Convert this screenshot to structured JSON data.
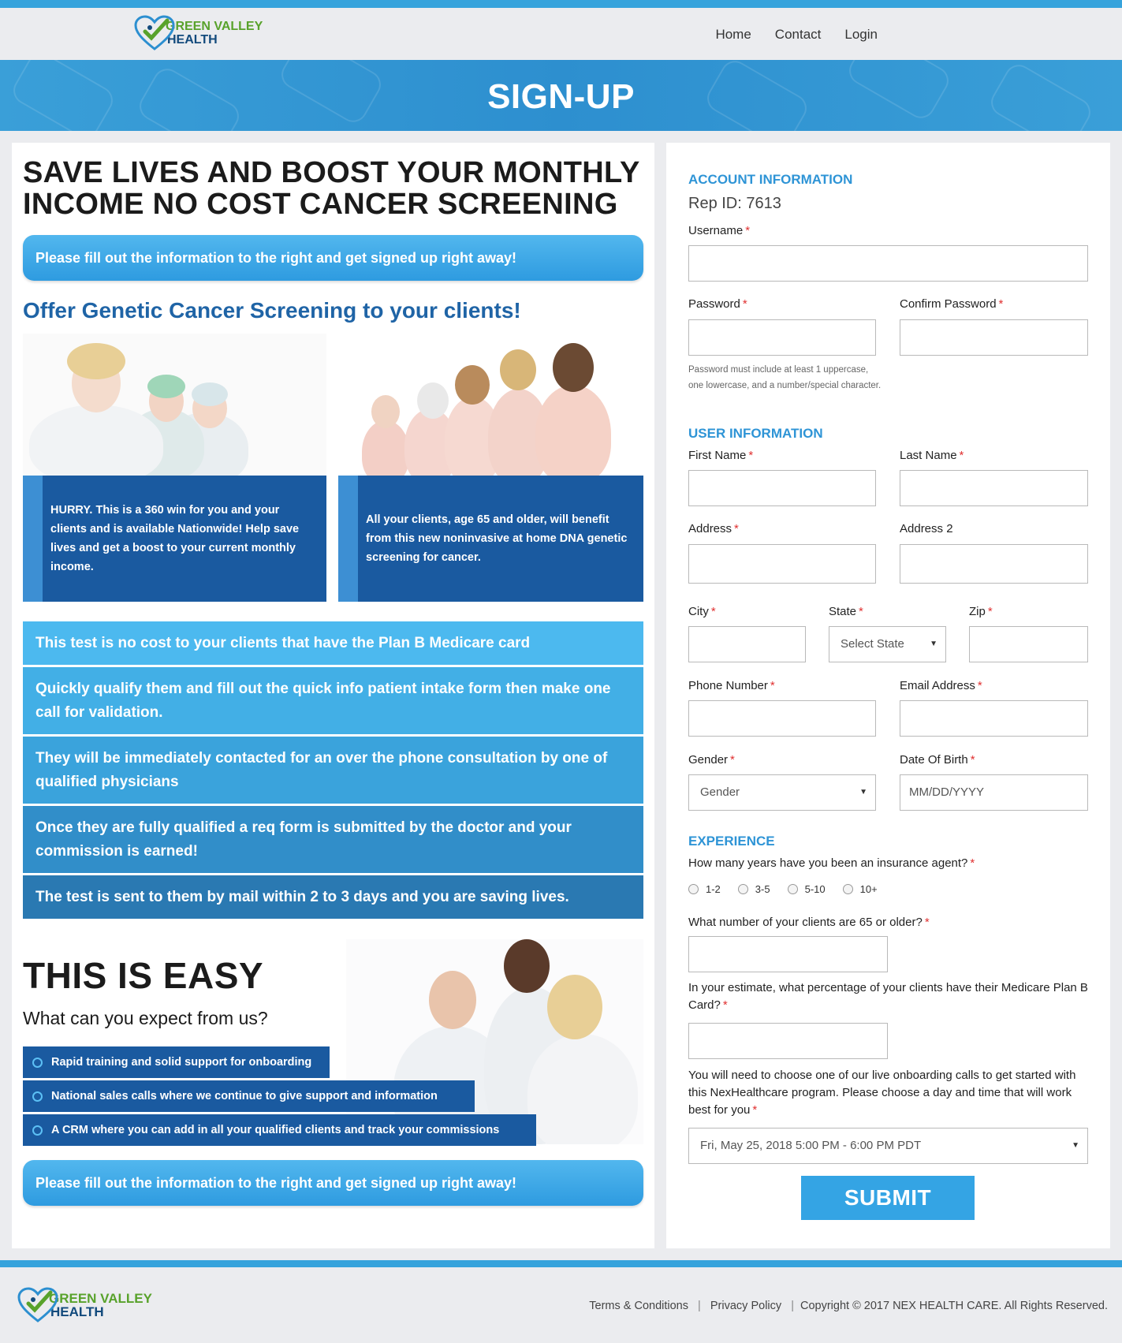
{
  "brand": {
    "line1": "GREEN VALLEY",
    "line2": "HEALTH"
  },
  "nav": {
    "home": "Home",
    "contact": "Contact",
    "login": "Login"
  },
  "banner": {
    "title": "SIGN-UP"
  },
  "left": {
    "title": "SAVE LIVES AND BOOST YOUR MONTHLY INCOME NO COST CANCER SCREENING",
    "cta_top": "Please fill out the information to the right and get signed up right away!",
    "subhead": "Offer Genetic Cancer Screening to your clients!",
    "box1": "HURRY. This is a 360 win for you and your clients and is available Nationwide! Help save lives and get a boost to your current monthly income.",
    "box2": "All your clients, age 65 and older, will benefit from this new noninvasive at home DNA genetic screening for cancer.",
    "steps": [
      "This test is no cost to your clients that have the Plan B Medicare card",
      "Quickly qualify them and fill out the quick info patient intake form then make one call for validation.",
      "They will be immediately contacted for an over the phone consultation by one of qualified physicians",
      "Once they are fully qualified a req form is submitted by the doctor and your commission is earned!",
      "The test is sent to them by mail within 2 to 3 days and you are saving lives."
    ],
    "step_colors": [
      "#4cb9ef",
      "#42afe6",
      "#3aa3dc",
      "#318ec9",
      "#2a79b2"
    ],
    "easy_title": "THIS IS EASY",
    "expect": "What can you expect from us?",
    "bullets": [
      "Rapid training and solid support for onboarding",
      "National sales calls where we continue to give support and information",
      "A CRM where you can add in all your qualified clients and track your commissions"
    ],
    "cta_bottom": "Please fill out the information to the right and get signed up right away!"
  },
  "form": {
    "account_heading": "ACCOUNT INFORMATION",
    "rep_id": "Rep ID: 7613",
    "username": "Username",
    "password": "Password",
    "confirm_password": "Confirm Password",
    "password_hint": "Password must include at least 1 uppercase, one lowercase, and a number/special character.",
    "user_heading": "USER INFORMATION",
    "first_name": "First Name",
    "last_name": "Last Name",
    "address": "Address",
    "address2": "Address 2",
    "city": "City",
    "state": "State",
    "state_placeholder": "Select State",
    "zip": "Zip",
    "phone": "Phone Number",
    "email": "Email Address",
    "gender": "Gender",
    "gender_placeholder": "Gender",
    "dob": "Date Of Birth",
    "dob_placeholder": "MM/DD/YYYY",
    "experience_heading": "EXPERIENCE",
    "years_question": "How many years have you been an insurance agent?",
    "years_options": [
      "1-2",
      "3-5",
      "5-10",
      "10+"
    ],
    "clients_question": "What number of your clients are 65 or older?",
    "percent_question": "In your estimate, what percentage of your clients have their Medicare Plan B Card?",
    "onboarding_text": "You will need to choose one of our live onboarding calls to get started with this NexHealthcare program. Please choose a day and time that will work best for you",
    "onboarding_value": "Fri, May 25, 2018 5:00 PM - 6:00 PM PDT",
    "required_mark": "*",
    "submit": "SUBMIT"
  },
  "footer": {
    "terms": "Terms & Conditions",
    "privacy": "Privacy Policy",
    "copyright": "Copyright © 2017 NEX HEALTH CARE. All Rights Reserved."
  }
}
